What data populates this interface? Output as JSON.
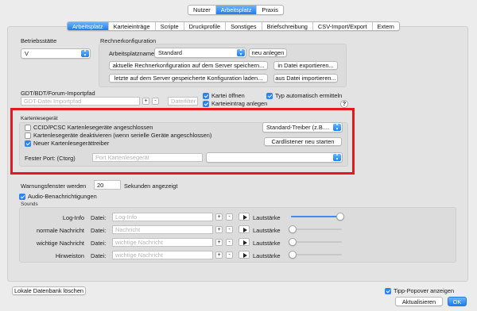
{
  "top_tabs": [
    {
      "label": "Nutzer",
      "active": false
    },
    {
      "label": "Arbeitsplatz",
      "active": true
    },
    {
      "label": "Praxis",
      "active": false
    }
  ],
  "sub_tabs": [
    {
      "label": "Arbeitsplatz",
      "active": true
    },
    {
      "label": "Karteieinträge",
      "active": false
    },
    {
      "label": "Scripte",
      "active": false
    },
    {
      "label": "Druckprofile",
      "active": false
    },
    {
      "label": "Sonstiges",
      "active": false
    },
    {
      "label": "Briefschreibung",
      "active": false
    },
    {
      "label": "CSV-Import/Export",
      "active": false
    },
    {
      "label": "Extern",
      "active": false
    }
  ],
  "betriebsstaette": {
    "label": "Betriebsstätte",
    "value": "V"
  },
  "rechner": {
    "title": "Rechnerkonfiguration",
    "arbeitsplatzname_label": "Arbeitsplatzname",
    "arbeitsplatzname_value": "Standard",
    "new_button": "neu anlegen",
    "btn_save_server": "aktuelle Rechnerkonfiguration auf dem Server speichern...",
    "btn_load_server": "letzte auf dem Server gespeicherte Konfiguration laden...",
    "btn_export": "in Datei exportieren...",
    "btn_import": "aus Datei importieren..."
  },
  "gdt": {
    "title": "GDT/BDT/Forum-Importpfad",
    "path_placeholder": "GDT-Datei Importpfad",
    "filter_placeholder": "Dateifilter",
    "plus": "+",
    "minus": "-",
    "kartei_oeffnen": "Kartei öffnen",
    "kartei_oeffnen_checked": true,
    "karteieintrag_anlegen": "Karteieintrag anlegen",
    "karteieintrag_anlegen_checked": true,
    "typ_auto": "Typ automatisch ermitteln",
    "typ_auto_checked": true,
    "help": "?"
  },
  "kartenleser": {
    "title": "Kartenlesegerät",
    "opt1": "CCID/PCSC Kartenlesegeräte angeschlossen",
    "opt1_checked": false,
    "opt2": "Kartenlesegeräte deaktivieren (wenn serielle Geräte angeschlossen)",
    "opt2_checked": false,
    "opt3": "Neuer Kartenlesegerättreiber",
    "opt3_checked": true,
    "driver_value": "Standard-Treiber (z.B....",
    "restart_button": "Cardlistener neu starten",
    "port_label": "Fester Port: (Ctorg)",
    "port_placeholder": "Port Kartenlesegerät",
    "port_select_value": ""
  },
  "warn": {
    "label_before": "Warnungsfenster werden",
    "value": "20",
    "label_after": "Sekunden angezeigt"
  },
  "audio": {
    "label": "Audio-Benachrichtigungen",
    "checked": true
  },
  "sounds": {
    "title": "Sounds",
    "file_label": "Datei:",
    "volume_label": "Lautstärke",
    "rows": [
      {
        "name": "Log-Info",
        "placeholder": "Log-Info",
        "volume": 1.0
      },
      {
        "name": "normale Nachricht",
        "placeholder": "Nachricht",
        "volume": 0.0
      },
      {
        "name": "wichtige Nachricht",
        "placeholder": "wichtige Nachricht",
        "volume": 0.0
      },
      {
        "name": "Hinweiston",
        "placeholder": "wichtige Nachricht",
        "volume": 0.0
      }
    ]
  },
  "footer": {
    "clear_db": "Lokale Datenbank löschen",
    "tipp_popover": "Tipp-Popover anzeigen",
    "tipp_checked": true,
    "refresh": "Aktualisieren",
    "ok": "OK"
  },
  "colors": {
    "accent": "#1b7ef2",
    "highlight_border": "#e4181e"
  }
}
